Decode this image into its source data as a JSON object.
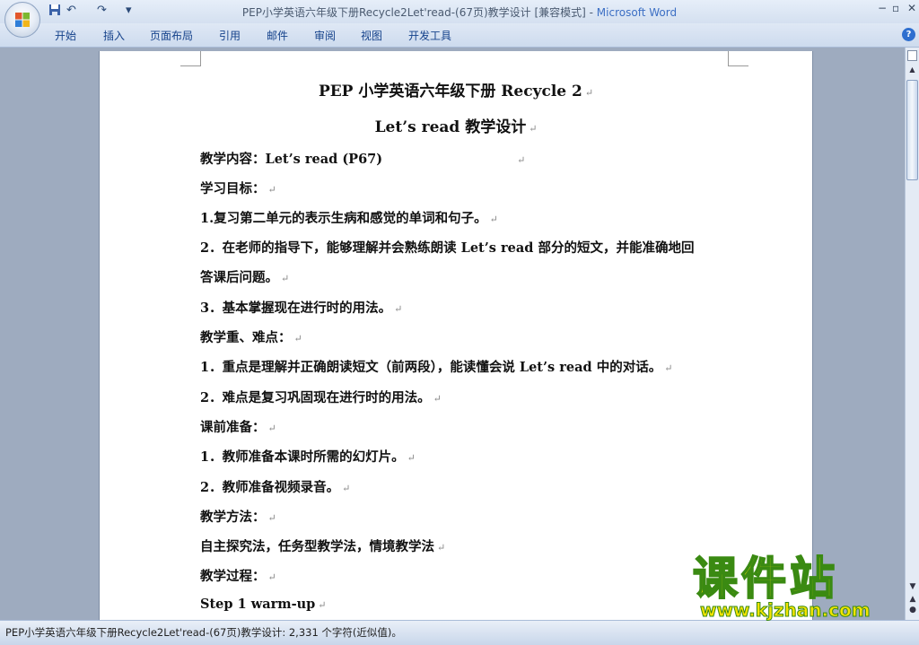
{
  "window": {
    "title_doc": "PEP小学英语六年级下册Recycle2Let'read-(67页)教学设计 [兼容模式] - ",
    "title_app": "Microsoft Word",
    "quick_access": {
      "save_icon": "save-icon",
      "undo_glyph": "↶",
      "redo_glyph": "↷",
      "customize_glyph": "▾"
    },
    "controls": {
      "minimize": "−",
      "restore": "▫",
      "close": "✕"
    }
  },
  "ribbon": {
    "tabs": [
      "开始",
      "插入",
      "页面布局",
      "引用",
      "邮件",
      "审阅",
      "视图",
      "开发工具"
    ],
    "help": "?"
  },
  "document": {
    "title1": "PEP 小学英语六年级下册 Recycle 2",
    "title2": "Let’s read 教学设计",
    "paragraph_mark": "↵",
    "lines": [
      "教学内容：Let’s read (P67)",
      "学习目标：",
      "1.复习第二单元的表示生病和感觉的单词和句子。",
      "2．在老师的指导下，能够理解并会熟练朗读 Let’s read 部分的短文，并能准确地回",
      "答课后问题。",
      "3．基本掌握现在进行时的用法。",
      "教学重、难点：",
      "1．重点是理解并正确朗读短文（前两段），能读懂会说 Let’s read  中的对话。",
      "2．难点是复习巩固现在进行时的用法。",
      "课前准备：",
      "1．教师准备本课时所需的幻灯片。",
      "2．教师准备视频录音。",
      "教学方法：",
      "自主探究法，任务型教学法，情境教学法",
      "教学过程：",
      "Step 1 warm-up"
    ]
  },
  "statusbar": {
    "text": "PEP小学英语六年级下册Recycle2Let'read-(67页)教学设计: 2,331 个字符(近似值)。"
  },
  "watermark": {
    "title": "课件站",
    "url": "www.kjzhan.com"
  },
  "colors": {
    "ribbon_text": "#15428b",
    "app_title": "#3c6fc4",
    "watermark_fill": "#f5e400",
    "watermark_stroke": "#3a8a12"
  }
}
